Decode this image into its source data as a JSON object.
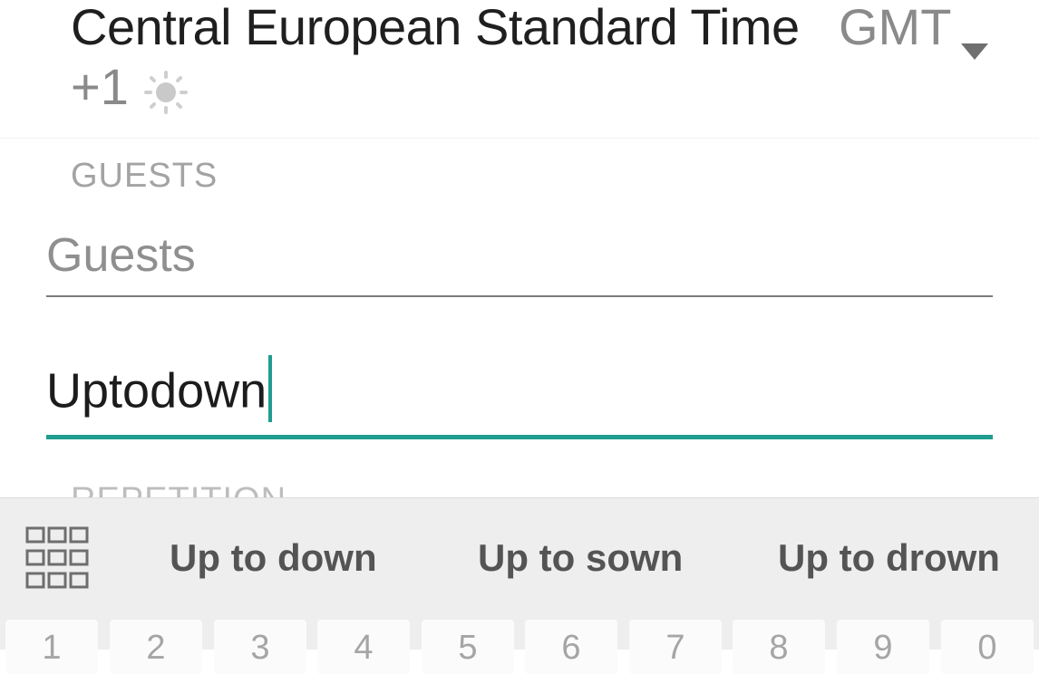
{
  "timezone": {
    "name": "Central European Standard Time",
    "gmt_label": "GMT",
    "offset": "+1",
    "dst_icon": "sun-icon",
    "dropdown_icon": "dropdown-arrow-icon"
  },
  "guests": {
    "section_label": "GUESTS",
    "placeholder": "Guests",
    "value": ""
  },
  "text_field": {
    "value": "Uptodown"
  },
  "repetition": {
    "section_label": "REPETITION"
  },
  "keyboard": {
    "menu_icon": "grid-icon",
    "suggestions": [
      "Up to down",
      "Up to sown",
      "Up to drown"
    ],
    "number_keys": [
      "1",
      "2",
      "3",
      "4",
      "5",
      "6",
      "7",
      "8",
      "9",
      "0"
    ]
  },
  "colors": {
    "accent": "#1f9d90",
    "keyboard_bg": "#eeeeee"
  }
}
